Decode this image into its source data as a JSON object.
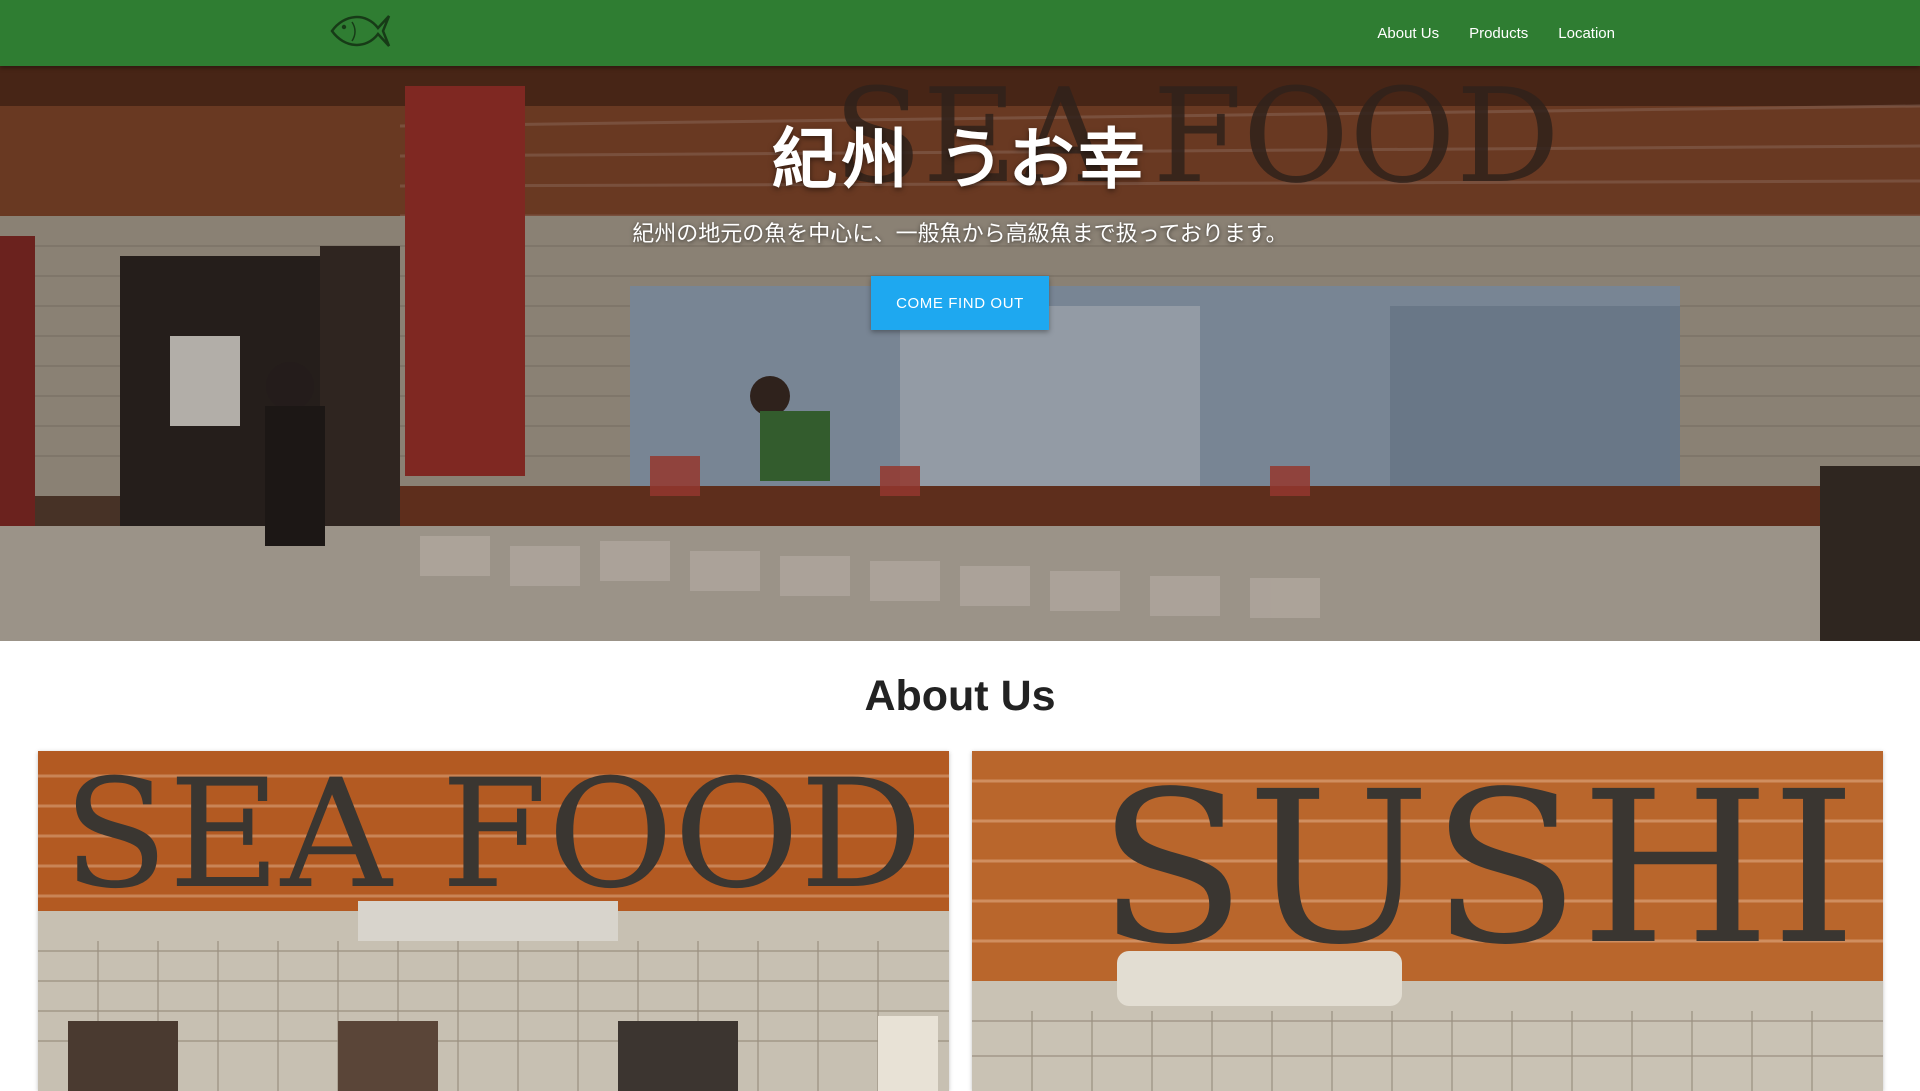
{
  "navbar": {
    "logo_icon": "fish-logo-icon",
    "links": [
      "About Us",
      "Products",
      "Location"
    ],
    "background": "#2f7d32"
  },
  "hero": {
    "title": "紀州 うお幸",
    "subtitle": "紀州の地元の魚を中心に、一般魚から高級魚まで扱っております。",
    "cta_label": "COME FIND OUT",
    "cta_color": "#1ea8f0",
    "background_sign_text": "SEA FOOD"
  },
  "about": {
    "heading": "About Us",
    "cards": [
      {
        "sign_text": "SEA FOOD"
      },
      {
        "sign_text": "SUSHI"
      }
    ]
  }
}
